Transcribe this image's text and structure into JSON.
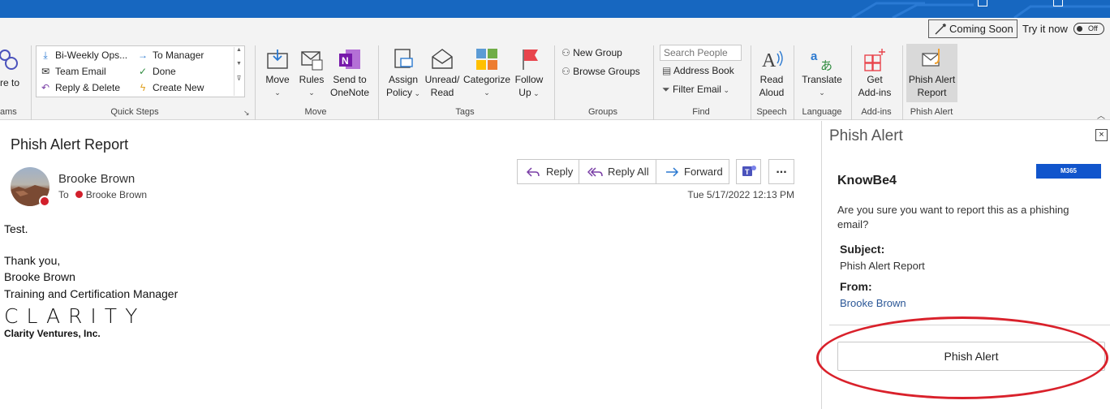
{
  "ribbon": {
    "coming_soon": "Coming Soon",
    "try_it_now": "Try it now",
    "toggle": "Off",
    "teams_cut": [
      "re to",
      "ams"
    ],
    "quick_steps": {
      "items": [
        "Bi-Weekly Ops...",
        "To Manager",
        "Team Email",
        "Done",
        "Reply & Delete",
        "Create New"
      ],
      "label": "Quick Steps"
    },
    "move": {
      "move": "Move",
      "rules": "Rules",
      "send_to": "Send to",
      "onenote": "OneNote",
      "label": "Move"
    },
    "tags": {
      "assign": "Assign",
      "policy": "Policy",
      "unread": "Unread/",
      "read": "Read",
      "categorize": "Categorize",
      "follow": "Follow",
      "up": "Up",
      "label": "Tags"
    },
    "groups": {
      "new_group": "New Group",
      "browse_groups": "Browse Groups",
      "label": "Groups"
    },
    "find": {
      "search_people_placeholder": "Search People",
      "address_book": "Address Book",
      "filter_email": "Filter Email",
      "label": "Find"
    },
    "speech": {
      "read": "Read",
      "aloud": "Aloud",
      "label": "Speech"
    },
    "language": {
      "translate": "Translate",
      "label": "Language"
    },
    "addins": {
      "get": "Get",
      "addins": "Add-ins",
      "label": "Add-ins"
    },
    "phish_alert": {
      "line1": "Phish Alert",
      "line2": "Report",
      "label": "Phish Alert"
    }
  },
  "email": {
    "subject": "Phish Alert Report",
    "sender": "Brooke Brown",
    "to_label": "To",
    "recipient": "Brooke Brown",
    "date": "Tue 5/17/2022 12:13 PM",
    "actions": {
      "reply": "Reply",
      "reply_all": "Reply All",
      "forward": "Forward",
      "more": "..."
    },
    "body": {
      "line1": "Test.",
      "line2": "Thank you,",
      "line3": "Brooke Brown",
      "line4": "Training and Certification Manager",
      "logo": "CLARITY",
      "company": "Clarity Ventures, Inc."
    }
  },
  "pane": {
    "title": "Phish Alert",
    "close": "×",
    "brand": "KnowBe4",
    "badge": "M365",
    "question": "Are you sure you want to report this as a phishing email?",
    "subject_label": "Subject:",
    "subject_value": "Phish Alert Report",
    "from_label": "From:",
    "from_value": "Brooke Brown",
    "button": "Phish Alert"
  },
  "colors": {
    "titlebar": "#1767c0",
    "presence": "#d21f2b",
    "highlight": "#d9212b",
    "badge": "#1155cc"
  }
}
